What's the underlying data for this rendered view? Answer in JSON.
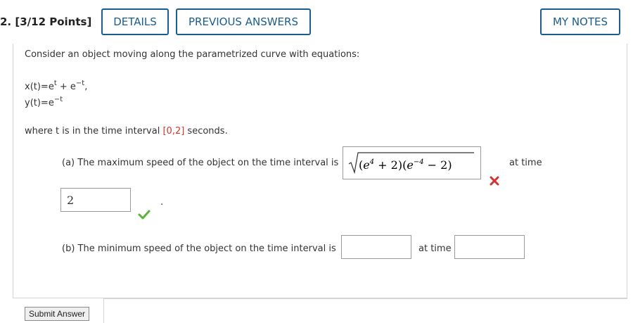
{
  "header": {
    "question_label": "2. [3/12 Points]",
    "details_button": "DETAILS",
    "previous_answers_button": "PREVIOUS ANSWERS",
    "my_notes_button": "MY NOTES"
  },
  "problem": {
    "intro": "Consider an object moving along the parametrized curve with equations:",
    "x_eq_prefix": "x(t)=e",
    "x_eq_sup1": "t",
    "x_eq_mid": " + e",
    "x_eq_sup2": "−t",
    "x_eq_suffix": ",",
    "y_eq_prefix": "y(t)=e",
    "y_eq_sup": "−t",
    "interval_prefix": "where t is in the time interval ",
    "interval_value": "[0,2]",
    "interval_suffix": " seconds."
  },
  "part_a": {
    "prompt": "(a) The maximum speed of the object on the time interval is",
    "speed_answer": "√((e⁴+2)(e⁻⁴−2))",
    "speed_status": "incorrect",
    "at_time_label": "at time",
    "time_answer": "2",
    "time_status": "correct",
    "period": "."
  },
  "part_b": {
    "prompt": "(b) The minimum speed of the object on the time interval is",
    "speed_answer": "",
    "at_time_label": "at time",
    "time_answer": ""
  },
  "footer": {
    "submit_label": "Submit Answer"
  },
  "colors": {
    "accent": "#1a5d8c",
    "incorrect": "#d0362f",
    "correct": "#5cb23a",
    "interval_highlight": "#d0362f"
  },
  "icons": {
    "incorrect": "x-mark-icon",
    "correct": "checkmark-icon"
  }
}
